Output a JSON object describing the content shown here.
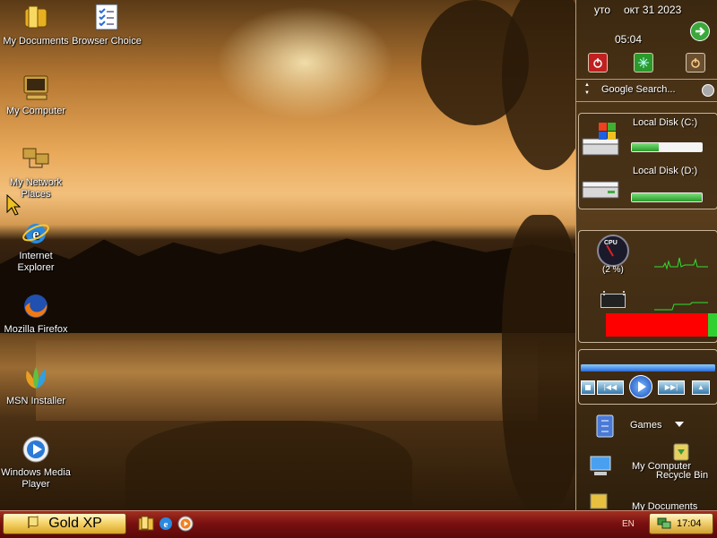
{
  "desktop": {
    "icons": [
      {
        "label": "My Documents"
      },
      {
        "label": "Browser Choice"
      },
      {
        "label": "My Computer"
      },
      {
        "label": "My Network Places"
      },
      {
        "label": "Internet Explorer"
      },
      {
        "label": "Mozilla Firefox"
      },
      {
        "label": "MSN Installer"
      },
      {
        "label": "Windows Media Player"
      }
    ]
  },
  "sidebar": {
    "clock": {
      "day": "уто",
      "date": "окт 31 2023",
      "time": "05:04"
    },
    "search": {
      "label": "Google Search..."
    },
    "disks": [
      {
        "label": "Local Disk (C:)",
        "usage": 0.38
      },
      {
        "label": "Local Disk (D:)",
        "usage": 1.0
      }
    ],
    "cpu": {
      "label": "CPU",
      "percent_text": "(2 %)",
      "percent": 2
    },
    "memory": {
      "usage": 0.92
    },
    "media": {
      "progress": 1.0
    },
    "links": [
      {
        "label": "Games"
      },
      {
        "label": "My Computer"
      },
      {
        "label": "Recycle Bin"
      },
      {
        "label": "My Documents"
      }
    ]
  },
  "taskbar": {
    "start_label": "Gold XP",
    "language": "EN",
    "clock": "17:04"
  },
  "colors": {
    "taskbar": "#7a1010",
    "start_button": "#f6d56c",
    "memory_bar": "#ff0000",
    "disk_bar": "#2a9a2a"
  }
}
